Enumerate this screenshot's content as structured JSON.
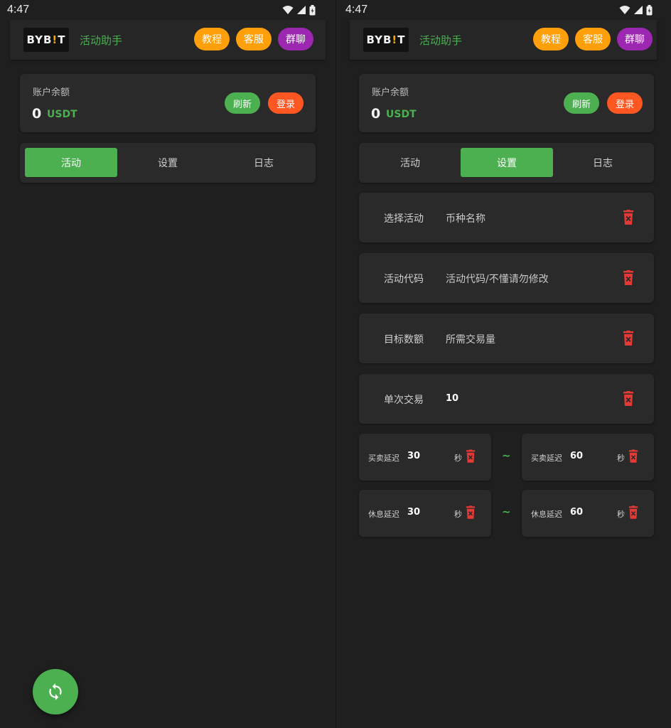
{
  "status": {
    "time": "4:47"
  },
  "header": {
    "logo_text_a": "BYB",
    "logo_text_b": "!",
    "logo_text_c": "T",
    "title": "活动助手",
    "tutorial_label": "教程",
    "service_label": "客服",
    "group_label": "群聊"
  },
  "balance": {
    "label": "账户余额",
    "value": "0",
    "unit": "USDT",
    "refresh_label": "刷新",
    "login_label": "登录"
  },
  "tabs": [
    {
      "label": "活动"
    },
    {
      "label": "设置"
    },
    {
      "label": "日志"
    }
  ],
  "screens": {
    "left": {
      "active_tab": "活动"
    },
    "right": {
      "active_tab": "设置"
    }
  },
  "settings": {
    "fields": [
      {
        "label": "选择活动",
        "value": "币种名称"
      },
      {
        "label": "活动代码",
        "value": "活动代码/不懂请勿修改"
      },
      {
        "label": "目标数额",
        "value": "所需交易量"
      },
      {
        "label": "单次交易",
        "value": "10"
      }
    ],
    "trade_delay": {
      "min": {
        "label": "买卖延迟",
        "value": "30",
        "unit": "秒"
      },
      "separator": "~",
      "max": {
        "label": "买卖延迟",
        "value": "60",
        "unit": "秒"
      }
    },
    "rest_delay": {
      "min": {
        "label": "休息延迟",
        "value": "30",
        "unit": "秒"
      },
      "separator": "~",
      "max": {
        "label": "休息延迟",
        "value": "60",
        "unit": "秒"
      }
    }
  },
  "icons": {
    "fab": "sync-icon",
    "delete": "trash-icon",
    "wifi": "wifi-icon",
    "signal": "signal-icon",
    "battery": "battery-icon"
  },
  "colors": {
    "green": "#4caf50",
    "orange": "#ff9f0a",
    "purple": "#9c27b0",
    "red_orange": "#ff5722",
    "danger": "#e53935",
    "background": "#1f1f1f",
    "card": "#2a2a2a"
  }
}
